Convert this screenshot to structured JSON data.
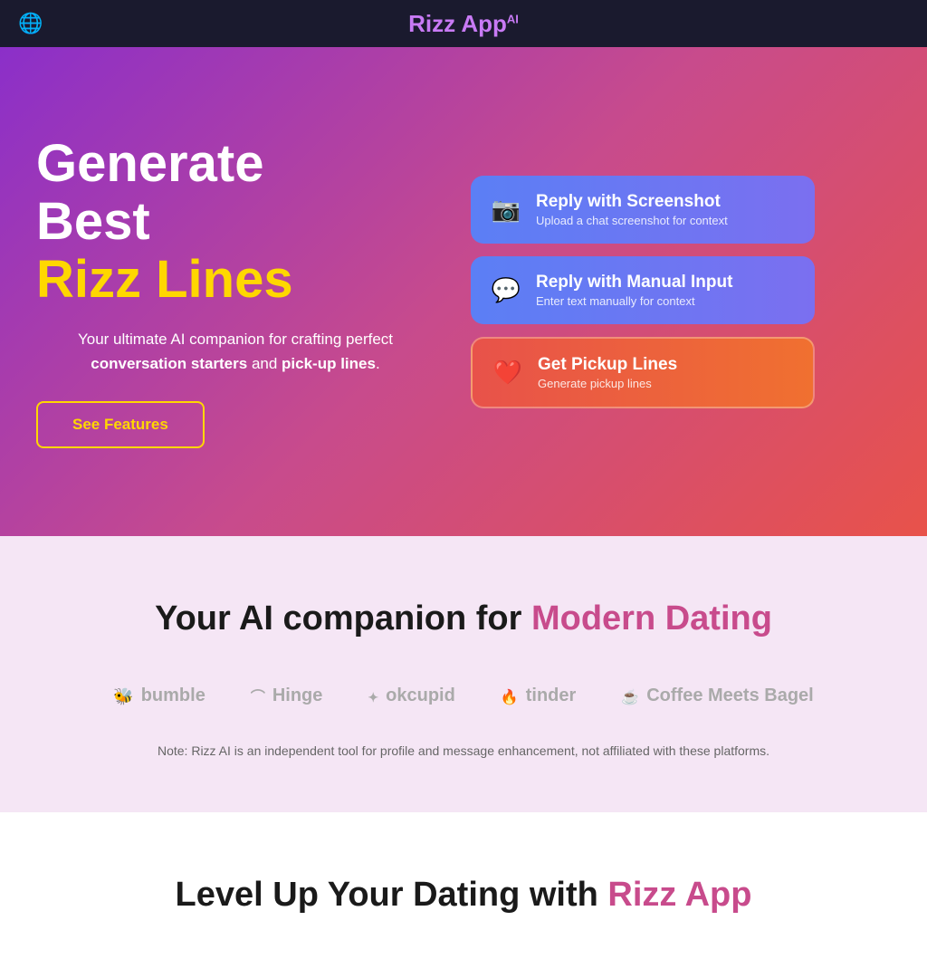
{
  "navbar": {
    "globe_icon": "🌐",
    "title_rizz": "Rizz App",
    "title_ai": "AI"
  },
  "hero": {
    "heading_line1": "Generate",
    "heading_line2": "Best",
    "heading_line3": "Rizz Lines",
    "description_plain": "Your ultimate AI companion for crafting perfect",
    "description_bold1": "conversation starters",
    "description_and": "and",
    "description_bold2": "pick-up lines",
    "description_end": ".",
    "see_features_label": "See Features"
  },
  "cards": [
    {
      "id": "screenshot",
      "icon": "📷",
      "title": "Reply with Screenshot",
      "subtitle": "Upload a chat screenshot for context"
    },
    {
      "id": "manual",
      "icon": "💬",
      "title": "Reply with Manual Input",
      "subtitle": "Enter text manually for context"
    },
    {
      "id": "pickup",
      "icon": "❤️",
      "title": "Get Pickup Lines",
      "subtitle": "Generate pickup lines"
    }
  ],
  "platforms": {
    "heading_plain": "Your AI companion for",
    "heading_colored": "Modern Dating",
    "logos": [
      {
        "name": "bumble",
        "icon": "bumble-icon",
        "label": "bumble"
      },
      {
        "name": "hinge",
        "icon": "hinge-icon",
        "label": "Hinge"
      },
      {
        "name": "okcupid",
        "icon": "okcupid-icon",
        "label": "okcupid"
      },
      {
        "name": "tinder",
        "icon": "tinder-icon",
        "label": "tinder"
      },
      {
        "name": "coffee-meets-bagel",
        "icon": "cmb-icon",
        "label": "Coffee Meets Bagel"
      }
    ],
    "note": "Note: Rizz AI is an independent tool for profile and message enhancement, not affiliated with these platforms."
  },
  "levelup": {
    "heading_plain": "Level Up Your Dating with",
    "heading_colored": "Rizz App"
  }
}
